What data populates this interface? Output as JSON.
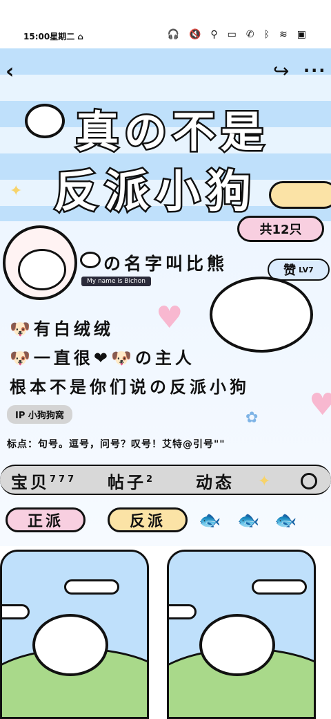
{
  "status_bar": {
    "time": "15:00",
    "weekday": "星期二"
  },
  "header": {
    "title_line1": "真の不是",
    "title_line2": "反派小狗",
    "count_label": "共12只"
  },
  "profile": {
    "name": "の名字叫比熊",
    "name_en": "My name is Bichon",
    "like_label": "赞",
    "like_value": "LV7",
    "bio_line1": "有白绒绒",
    "bio_line2": "一直很",
    "bio_line2_end": "の主人",
    "bio_line3": "根本不是你们说の反派小狗",
    "ip_prefix": "IP",
    "ip_text": "小狗狗窝",
    "punctuation": "标点：句号。逗号，问号？叹号！艾特@引号\"\""
  },
  "tabs": [
    {
      "label": "宝贝",
      "badge": "777"
    },
    {
      "label": "帖子",
      "badge": "2"
    },
    {
      "label": "动态",
      "badge": ""
    }
  ],
  "chips": [
    {
      "label": "正派"
    },
    {
      "label": "反派"
    }
  ],
  "colors": {
    "blue": "#bfe0fb",
    "pink": "#f8cfe0",
    "yellow": "#fbe3a6",
    "green": "#a9d98a"
  }
}
